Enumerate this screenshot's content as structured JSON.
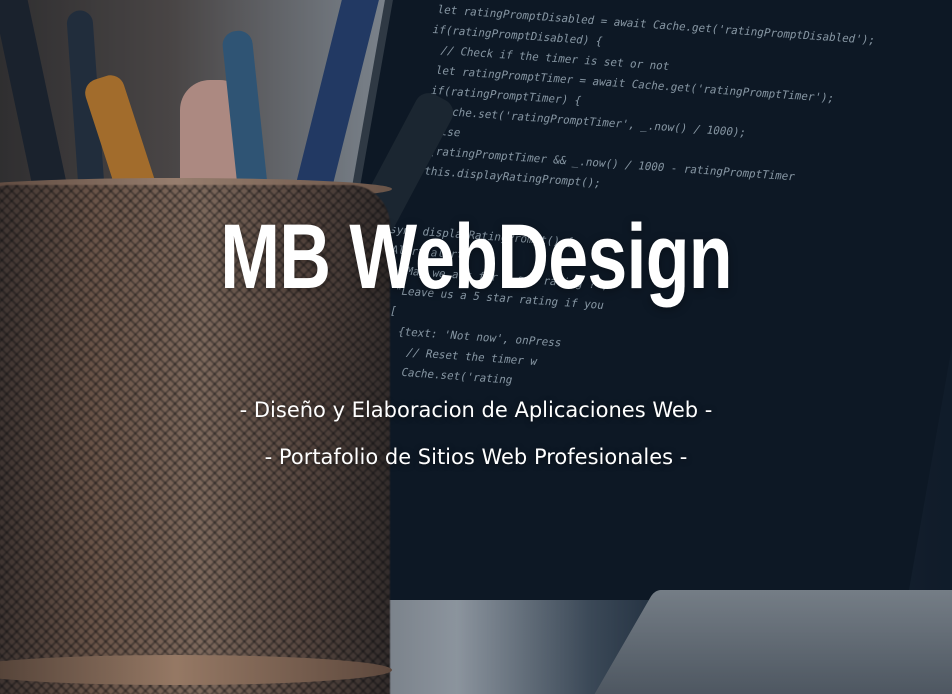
{
  "hero": {
    "title": "MB WebDesign",
    "subtitle_1": "- Diseño y Elaboracion de Aplicaciones Web -",
    "subtitle_2": "- Portafolio de Sitios Web Profesionales -"
  },
  "background": {
    "code_lines": [
      "let ratingPromptDisabled = await Cache.get('ratingPromptDisabled');",
      "",
      "if(ratingPromptDisabled) {",
      "  // Check if the timer is set or not",
      "  let ratingPromptTimer = await Cache.get('ratingPromptTimer');",
      "",
      "  if(ratingPromptTimer) {",
      "    Cache.set('ratingPromptTimer', _.now() / 1000);",
      "  } else",
      "  if(ratingPromptTimer && _.now() / 1000 - ratingPromptTimer",
      "    this.displayRatingPrompt();",
      "  }",
      "}",
      "",
      "",
      "async displayRatingPrompt() {",
      "  Alert.alert(",
      "    \"May we ask for a goo rating ?\",",
      "    \"Leave us a 5 star rating if you",
      "    [",
      "      {text: 'Not now', onPress",
      "        // Reset the timer w",
      "        Cache.set('rating"
    ]
  }
}
